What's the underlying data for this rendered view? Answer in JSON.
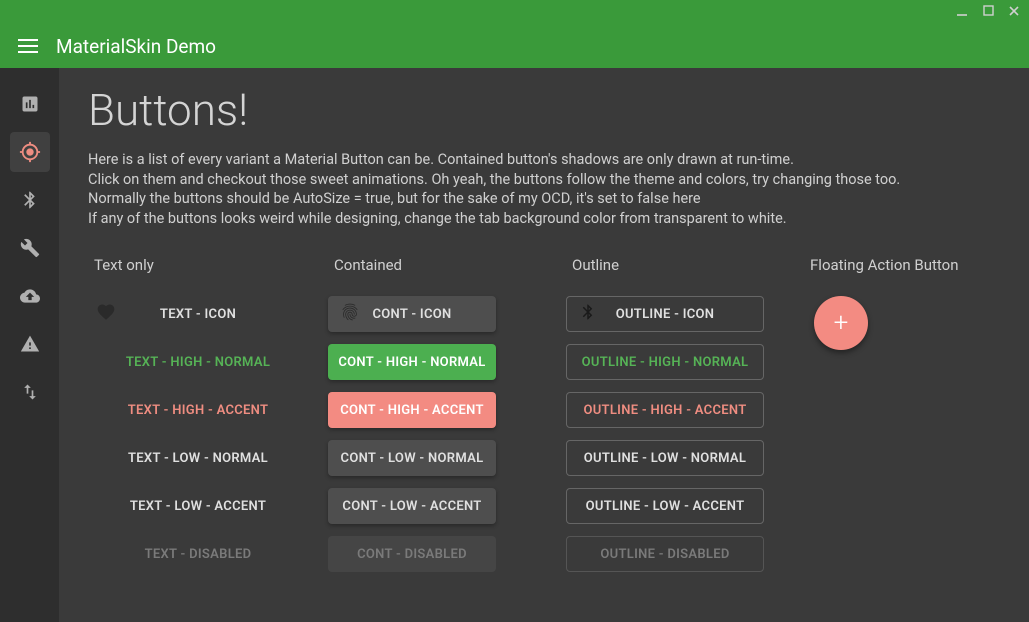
{
  "app": {
    "title": "MaterialSkin Demo"
  },
  "page": {
    "title": "Buttons!",
    "desc_line1": "Here is a list of every variant a Material Button can be. Contained button's shadows are only drawn at run-time.",
    "desc_line2": "Click on them and checkout those sweet animations. Oh yeah, the buttons follow the theme and colors, try changing those too.",
    "desc_line3": "Normally the buttons should be AutoSize = true, but for the sake of my OCD, it's set to false here",
    "desc_line4": "If any of the buttons looks weird while designing, change the tab background color from transparent to white."
  },
  "columns": {
    "text": {
      "header": "Text only",
      "rows": {
        "icon": "TEXT - ICON",
        "high_normal": "TEXT - HIGH - NORMAL",
        "high_accent": "TEXT - HIGH - ACCENT",
        "low_normal": "TEXT - LOW - NORMAL",
        "low_accent": "TEXT - LOW - ACCENT",
        "disabled": "TEXT - DISABLED"
      }
    },
    "contained": {
      "header": "Contained",
      "rows": {
        "icon": "CONT - ICON",
        "high_normal": "CONT - HIGH - NORMAL",
        "high_accent": "CONT - HIGH - ACCENT",
        "low_normal": "CONT - LOW - NORMAL",
        "low_accent": "CONT - LOW - ACCENT",
        "disabled": "CONT - DISABLED"
      }
    },
    "outline": {
      "header": "Outline",
      "rows": {
        "icon": "OUTLINE - ICON",
        "high_normal": "OUTLINE - HIGH - NORMAL",
        "high_accent": "OUTLINE - HIGH - ACCENT",
        "low_normal": "OUTLINE - LOW - NORMAL",
        "low_accent": "OUTLINE - LOW - ACCENT",
        "disabled": "OUTLINE - DISABLED"
      }
    },
    "fab": {
      "header": "Floating Action Button"
    }
  },
  "colors": {
    "primary": "#3a9a3a",
    "accent": "#f38b82",
    "surface": "#3a3a3a"
  }
}
